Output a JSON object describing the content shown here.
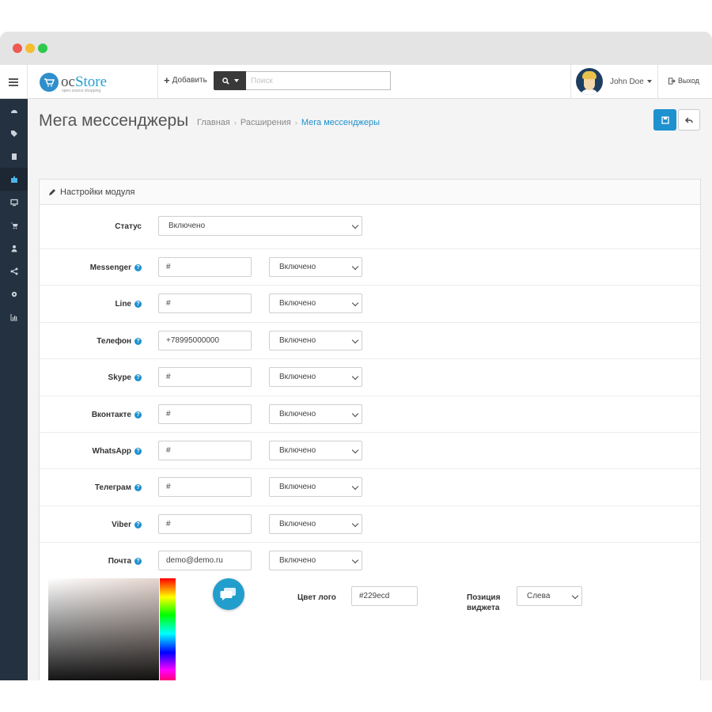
{
  "header": {
    "logo_oc": "oc",
    "logo_store": "Store",
    "logo_sub": "open source shopping",
    "add_label": "Добавить",
    "search_placeholder": "Поиск",
    "user_name": "John Doe",
    "logout_label": "Выход"
  },
  "sidebar": {
    "items": [
      "dashboard-icon",
      "tags-icon",
      "book-icon",
      "puzzle-icon",
      "desktop-icon",
      "cart-icon",
      "user-icon",
      "share-icon",
      "cog-icon",
      "bar-chart-icon"
    ],
    "active_index": 3
  },
  "page": {
    "title": "Мега мессенджеры",
    "breadcrumbs": [
      "Главная",
      "Расширения",
      "Мега мессенджеры"
    ]
  },
  "panel": {
    "heading": "Настройки модуля",
    "status_label": "Статус",
    "status_value": "Включено",
    "rows": [
      {
        "label": "Messenger",
        "value": "#",
        "status": "Включено"
      },
      {
        "label": "Line",
        "value": "#",
        "status": "Включено"
      },
      {
        "label": "Телефон",
        "value": "+78995000000",
        "status": "Включено"
      },
      {
        "label": "Skype",
        "value": "#",
        "status": "Включено"
      },
      {
        "label": "Вконтакте",
        "value": "#",
        "status": "Включено"
      },
      {
        "label": "WhatsApp",
        "value": "#",
        "status": "Включено"
      },
      {
        "label": "Телеграм",
        "value": "#",
        "status": "Включено"
      },
      {
        "label": "Viber",
        "value": "#",
        "status": "Включено"
      },
      {
        "label": "Почта",
        "value": "demo@demo.ru",
        "status": "Включено"
      }
    ],
    "logo_color_label": "Цвет лого",
    "logo_color_value": "#229ecd",
    "widget_position_label_1": "Позиция",
    "widget_position_label_2": "виджета",
    "widget_position_value": "Слева"
  },
  "colors": {
    "accent": "#1e91cf",
    "sidebar": "#233140",
    "logo_color": "#229ecd"
  }
}
